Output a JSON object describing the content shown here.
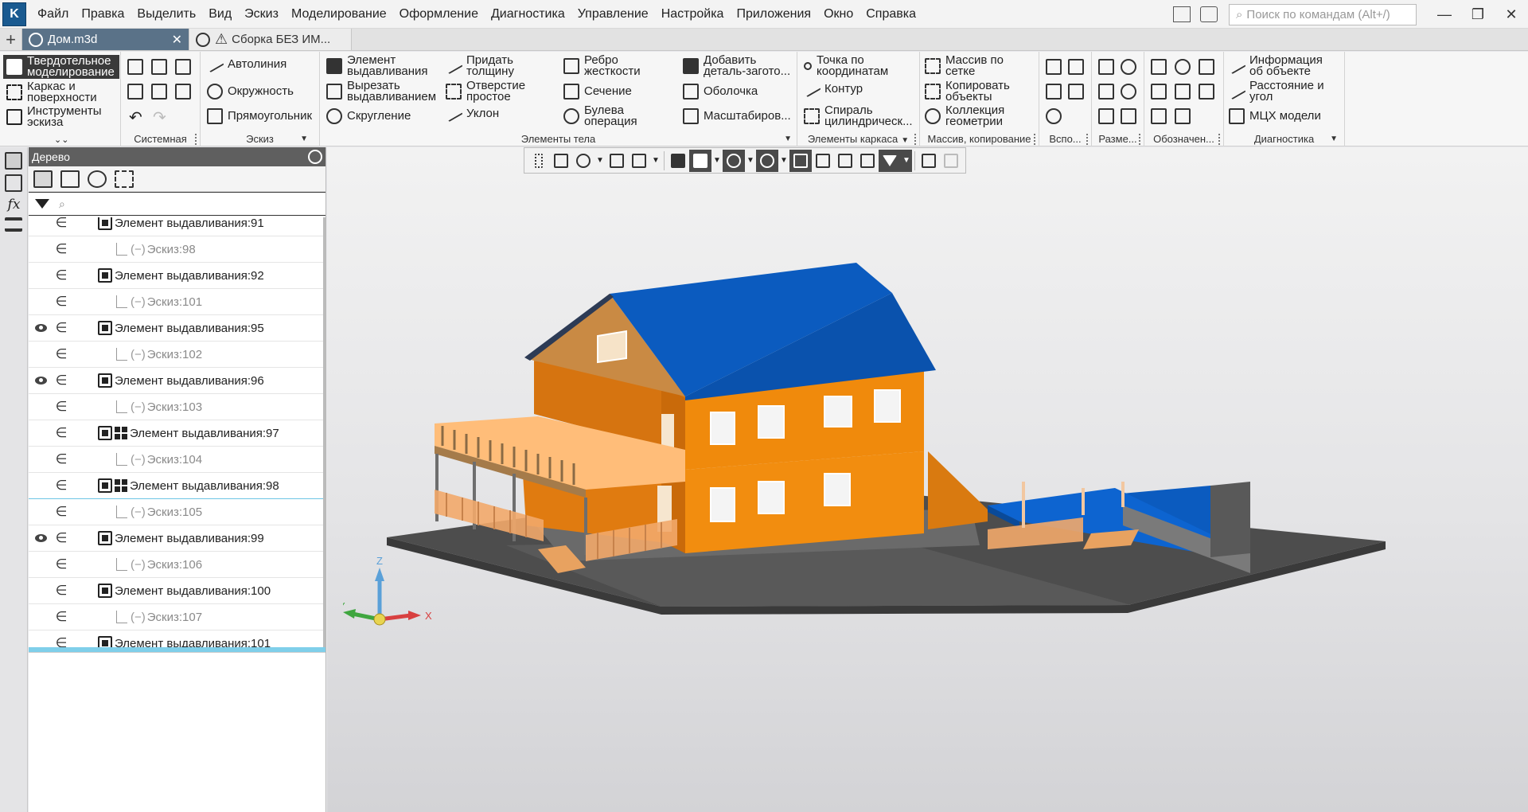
{
  "menu": [
    "Файл",
    "Правка",
    "Выделить",
    "Вид",
    "Эскиз",
    "Моделирование",
    "Оформление",
    "Диагностика",
    "Управление",
    "Настройка",
    "Приложения",
    "Окно",
    "Справка"
  ],
  "search": {
    "placeholder": "Поиск по командам (Alt+/)"
  },
  "tabs": [
    {
      "label": "Дом.m3d",
      "close": "✕"
    },
    {
      "label": "Сборка БЕЗ ИМ..."
    }
  ],
  "modes": [
    "Твердотельное моделирование",
    "Каркас и поверхности",
    "Инструменты эскиза"
  ],
  "ribbon": {
    "groups": {
      "system": "Системная",
      "sketch": "Эскиз",
      "body": "Элементы тела",
      "frame": "Элементы каркаса",
      "array": "Массив, копирование",
      "aux": "Вспо...",
      "dims": "Разме...",
      "marks": "Обозначен...",
      "diag": "Диагностика"
    },
    "sketch": [
      "Автолиния",
      "Окружность",
      "Прямоугольник"
    ],
    "body": [
      "Элемент выдавливания",
      "Вырезать выдавливанием",
      "Скругление",
      "Придать толщину",
      "Отверстие простое",
      "Уклон",
      "Ребро жесткости",
      "Сечение",
      "Булева операция",
      "Добавить деталь-загото...",
      "Оболочка",
      "Масштабиров..."
    ],
    "frame": [
      "Точка по координатам",
      "Контур",
      "Спираль цилиндрическ..."
    ],
    "array": [
      "Массив по сетке",
      "Копировать объекты",
      "Коллекция геометрии"
    ],
    "diag": [
      "Информация об объекте",
      "Расстояние и угол",
      "МЦХ модели"
    ]
  },
  "tree": {
    "title": "Дерево",
    "rel_symbol": "∈",
    "sketch_prefix": "(−)",
    "rows": [
      {
        "kind": "feature",
        "label": "Элемент выдавливания:91",
        "eye": false
      },
      {
        "kind": "sketch",
        "label": "Эскиз:98"
      },
      {
        "kind": "feature",
        "label": "Элемент выдавливания:92",
        "eye": false
      },
      {
        "kind": "sketch",
        "label": "Эскиз:101"
      },
      {
        "kind": "feature",
        "label": "Элемент выдавливания:95",
        "eye": true
      },
      {
        "kind": "sketch",
        "label": "Эскиз:102"
      },
      {
        "kind": "feature",
        "label": "Элемент выдавливания:96",
        "eye": true
      },
      {
        "kind": "sketch",
        "label": "Эскиз:103"
      },
      {
        "kind": "feature-tiles",
        "label": "Элемент выдавливания:97",
        "eye": false
      },
      {
        "kind": "sketch",
        "label": "Эскиз:104"
      },
      {
        "kind": "feature-tiles",
        "label": "Элемент выдавливания:98",
        "eye": false,
        "selected": true
      },
      {
        "kind": "sketch",
        "label": "Эскиз:105"
      },
      {
        "kind": "feature",
        "label": "Элемент выдавливания:99",
        "eye": true
      },
      {
        "kind": "sketch",
        "label": "Эскиз:106"
      },
      {
        "kind": "feature",
        "label": "Элемент выдавливания:100",
        "eye": false
      },
      {
        "kind": "sketch",
        "label": "Эскиз:107"
      },
      {
        "kind": "feature",
        "label": "Элемент выдавливания:101",
        "eye": false
      }
    ]
  },
  "axes": {
    "x": "X",
    "y": "Y",
    "z": "Z"
  },
  "colors": {
    "roof": "#0b5bbf",
    "wall": "#f08a0c",
    "gable": "#c98a44",
    "deck": "#ffbd79",
    "ground": "#4d4d4d",
    "accent": "#1a5a90"
  }
}
